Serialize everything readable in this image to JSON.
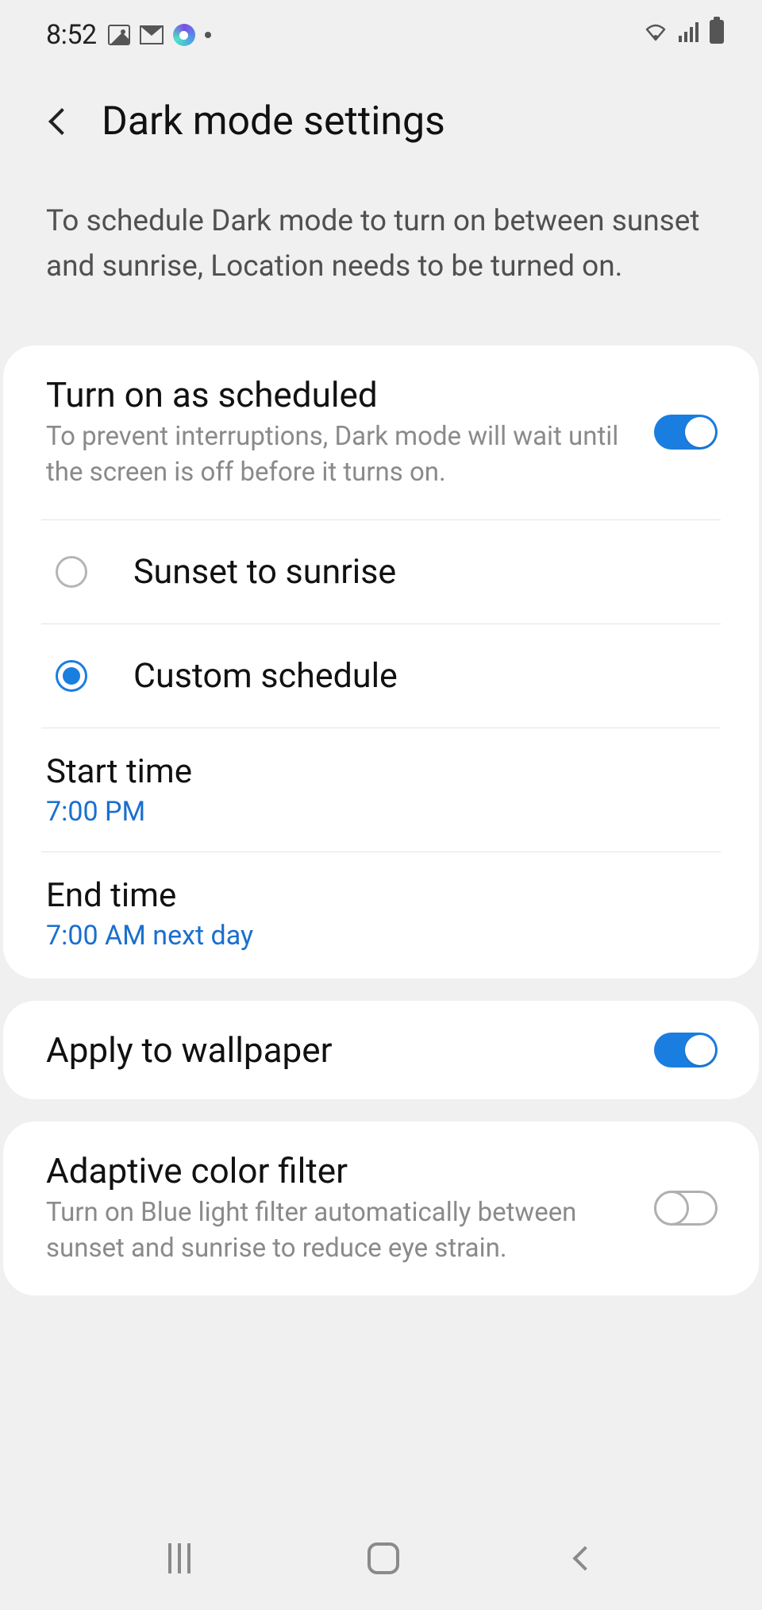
{
  "status": {
    "time": "8:52"
  },
  "header": {
    "title": "Dark mode settings"
  },
  "description": "To schedule Dark mode to turn on between sunset and sunrise, Location needs to be turned on.",
  "schedule": {
    "title": "Turn on as scheduled",
    "subtitle": "To prevent interruptions, Dark mode will wait until the screen is off before it turns on.",
    "enabled": true,
    "options": {
      "sunset": "Sunset to sunrise",
      "custom": "Custom schedule",
      "selected": "custom"
    },
    "start": {
      "label": "Start time",
      "value": "7:00 PM"
    },
    "end": {
      "label": "End time",
      "value": "7:00 AM next day"
    }
  },
  "wallpaper": {
    "label": "Apply to wallpaper",
    "enabled": true
  },
  "adaptive": {
    "label": "Adaptive color filter",
    "subtitle": "Turn on Blue light filter automatically between sunset and sunrise to reduce eye strain.",
    "enabled": false
  }
}
